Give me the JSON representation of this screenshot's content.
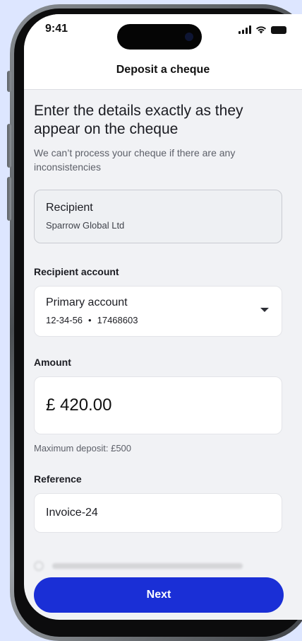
{
  "status_bar": {
    "time": "9:41"
  },
  "header": {
    "title": "Deposit a cheque"
  },
  "main": {
    "heading": "Enter the details exactly as they appear on the cheque",
    "subtext": "We can’t process your cheque if there are any inconsistencies",
    "recipient": {
      "label": "Recipient",
      "value": "Sparrow Global Ltd"
    },
    "recipient_account": {
      "section_label": "Recipient account",
      "account_name": "Primary account",
      "sort_code": "12-34-56",
      "separator": "•",
      "account_number": "17468603"
    },
    "amount": {
      "section_label": "Amount",
      "value": "£ 420.00",
      "helper": "Maximum deposit: £500"
    },
    "reference": {
      "section_label": "Reference",
      "value": "Invoice-24"
    }
  },
  "footer": {
    "next_label": "Next"
  },
  "colors": {
    "primary": "#1a2fd6",
    "background": "#f1f2f5",
    "page_bg": "#dde6ff"
  }
}
